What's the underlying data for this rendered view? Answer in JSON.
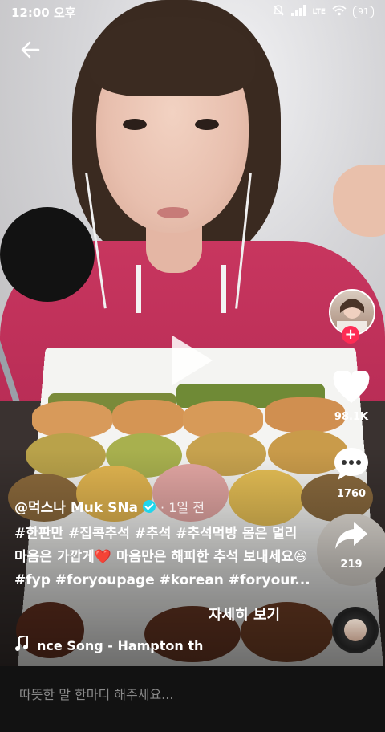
{
  "status_bar": {
    "time": "12:00 오후",
    "battery": "91",
    "network": "LTE"
  },
  "video": {
    "creator_handle": "@먹스나 Muk SNa",
    "posted_ago": "· 1일 전",
    "description": "#한판만 #집콕추석 #추석 #추석먹방 몸은 멀리 마음은 가깝게❤️ 마음만은 해피한 추석 보내세요😆 #fyp #foryoupage #korean #foryour...",
    "see_more": "자세히 보기",
    "music": "nce Song - Hampton th"
  },
  "rail": {
    "likes": "98.1K",
    "comments": "1760",
    "shares": "219"
  },
  "comment_bar": {
    "placeholder": "따뜻한 말 한마디 해주세요..."
  },
  "colors": {
    "follow_plus": "#fe2c55",
    "verified": "#20d5ec"
  }
}
